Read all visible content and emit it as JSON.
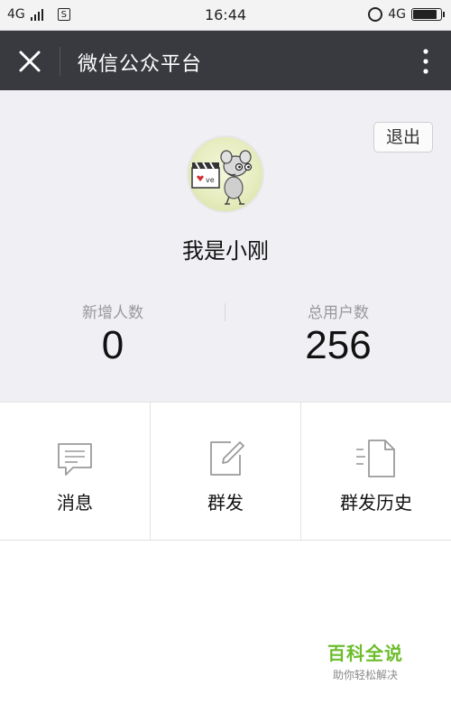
{
  "status_bar": {
    "network_left": "4G",
    "sim_label": "S",
    "time": "16:44",
    "network_right": "4G",
    "battery_level": 0.85
  },
  "header": {
    "title": "微信公众平台",
    "close_icon": "close-icon",
    "more_icon": "more-vertical-icon"
  },
  "profile": {
    "logout_label": "退出",
    "name": "我是小刚",
    "avatar_icon": "cartoon-mouse-avatar"
  },
  "stats": {
    "new_users_label": "新增人数",
    "new_users_value": "0",
    "total_users_label": "总用户数",
    "total_users_value": "256"
  },
  "menu": {
    "items": [
      {
        "label": "消息",
        "icon": "message-icon"
      },
      {
        "label": "群发",
        "icon": "edit-icon"
      },
      {
        "label": "群发历史",
        "icon": "history-document-icon"
      }
    ]
  },
  "watermark": {
    "title": "百科全说",
    "subtitle": "助你轻松解决"
  },
  "colors": {
    "header_bg": "#393a3f",
    "profile_bg": "#f0eff4",
    "watermark_green": "#6cbd2c"
  }
}
